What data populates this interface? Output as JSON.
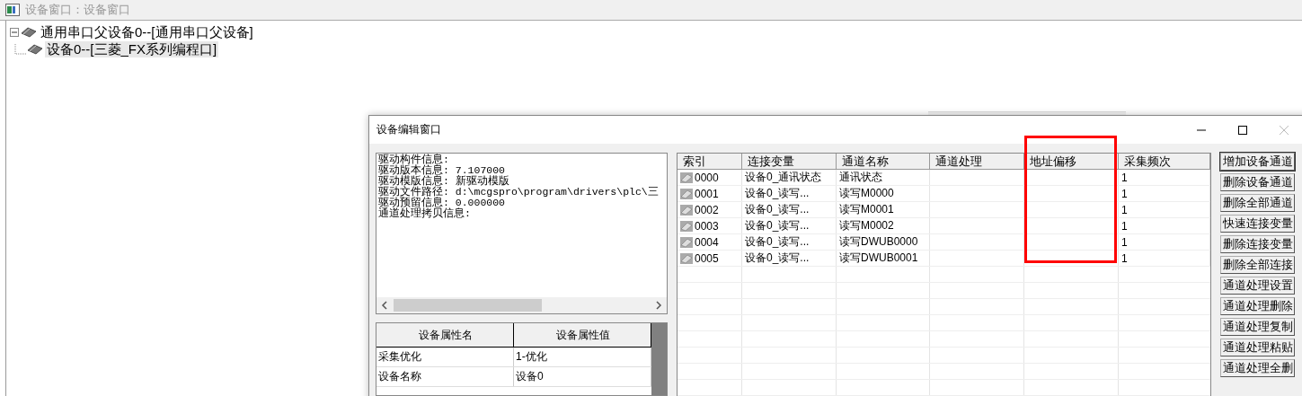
{
  "window": {
    "title": "设备窗口：设备窗口"
  },
  "tree": [
    {
      "label": "通用串口父设备0--[通用串口父设备]",
      "expanded": true,
      "selected": false,
      "children": [
        {
          "label": "设备0--[三菱_FX系列编程口]",
          "selected": true
        }
      ]
    }
  ],
  "dialog": {
    "title": "设备编辑窗口",
    "info_lines": [
      "驱动构件信息:",
      "驱动版本信息: 7.107000",
      "驱动模版信息: 新驱动模版",
      "驱动文件路径: d:\\mcgspro\\program\\drivers\\plc\\三",
      "驱动预留信息: 0.000000",
      "通道处理拷贝信息:"
    ],
    "properties": {
      "columns": [
        "设备属性名",
        "设备属性值"
      ],
      "rows": [
        [
          "采集优化",
          "1-优化"
        ],
        [
          "设备名称",
          "设备0"
        ]
      ]
    },
    "channels": {
      "columns": [
        {
          "label": "索引",
          "highlighted": false
        },
        {
          "label": "连接变量",
          "highlighted": false
        },
        {
          "label": "通道名称",
          "highlighted": false
        },
        {
          "label": "通道处理",
          "highlighted": false
        },
        {
          "label": "地址偏移",
          "highlighted": true
        },
        {
          "label": "采集频次",
          "highlighted": false
        }
      ],
      "rows": [
        [
          "0000",
          "设备0_通讯状态",
          "通讯状态",
          "",
          "",
          "1"
        ],
        [
          "0001",
          "设备0_读写...",
          "读写M0000",
          "",
          "",
          "1"
        ],
        [
          "0002",
          "设备0_读写...",
          "读写M0001",
          "",
          "",
          "1"
        ],
        [
          "0003",
          "设备0_读写...",
          "读写M0002",
          "",
          "",
          "1"
        ],
        [
          "0004",
          "设备0_读写...",
          "读写DWUB0000",
          "",
          "",
          "1"
        ],
        [
          "0005",
          "设备0_读写...",
          "读写DWUB0001",
          "",
          "",
          "1"
        ]
      ]
    },
    "buttons": [
      "增加设备通道",
      "删除设备通道",
      "删除全部通道",
      "快速连接变量",
      "删除连接变量",
      "删除全部连接",
      "通道处理设置",
      "通道处理删除",
      "通道处理复制",
      "通道处理粘贴",
      "通道处理全删"
    ]
  }
}
